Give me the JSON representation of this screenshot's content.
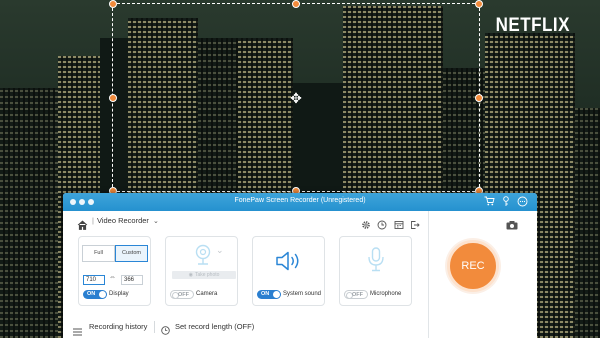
{
  "scene": {
    "brand_logo": "NETFLIX"
  },
  "window": {
    "title": "FonePaw Screen Recorder (Unregistered)",
    "titlebar_icons": [
      "cart-icon",
      "key-icon",
      "chat-icon"
    ]
  },
  "toolbar": {
    "mode_label": "Video Recorder",
    "right_tools": [
      "gear-icon",
      "clock-icon",
      "calendar-icon",
      "exit-icon",
      "camera-icon"
    ]
  },
  "display_panel": {
    "full_label": "Full",
    "custom_label": "Custom",
    "width_value": "710",
    "height_value": "366",
    "toggle_state": "ON",
    "label": "Display"
  },
  "camera_panel": {
    "take_photo_label": "Take photo",
    "toggle_state": "OFF",
    "label": "Camera"
  },
  "system_sound_panel": {
    "toggle_state": "ON",
    "label": "System sound"
  },
  "microphone_panel": {
    "toggle_state": "OFF",
    "label": "Microphone"
  },
  "rec_label": "REC",
  "bottom_bar": {
    "history_label": "Recording history",
    "length_label": "Set record length (OFF)"
  },
  "colors": {
    "accent": "#2a7fd0",
    "titlebar": "#2f9ad4",
    "rec": "#f28b3c"
  }
}
